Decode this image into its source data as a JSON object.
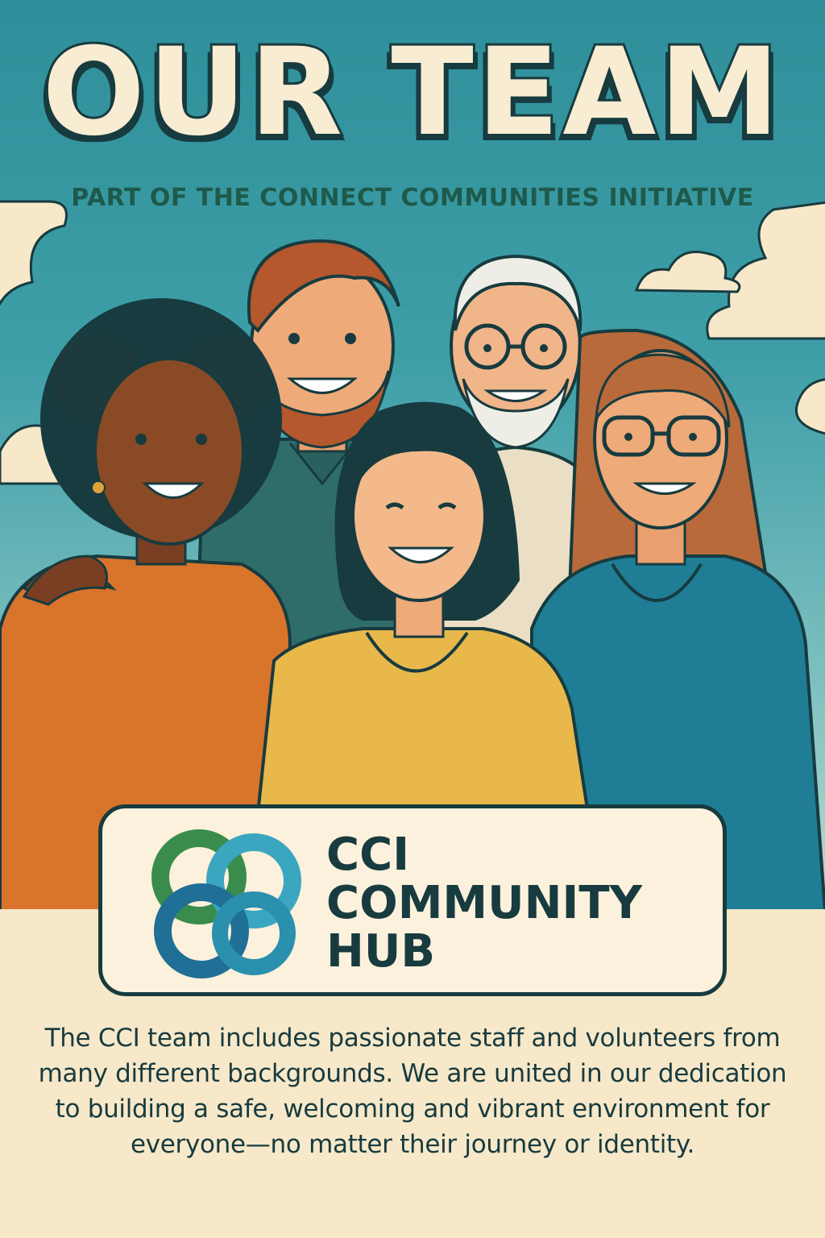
{
  "poster": {
    "title": "OUR TEAM",
    "subtitle": "PART OF THE CONNECT COMMUNITIES INITIATIVE",
    "logo": {
      "line1": "CCI",
      "line2": "COMMUNITY",
      "line3": "HUB"
    },
    "description": "The CCI team includes passionate staff and volunteers from many different backgrounds. We are united in our dedication to building a safe, welcoming and vibrant environment for everyone—no matter their journey or identity."
  },
  "colors": {
    "sky": "#3f9fa8",
    "cream": "#f6e8c9",
    "ink": "#173b3f",
    "subtitle": "#1e5a4b",
    "logo_green": "#3a8c4c",
    "logo_blue": "#1f6f96",
    "logo_teal": "#3aa6c0"
  },
  "illustration": {
    "people": [
      "woman-curly-hair-orange-shirt",
      "man-beard-green-shirt",
      "woman-black-hair-yellow-shirt",
      "older-man-glasses",
      "woman-glasses-blue-shirt"
    ]
  }
}
